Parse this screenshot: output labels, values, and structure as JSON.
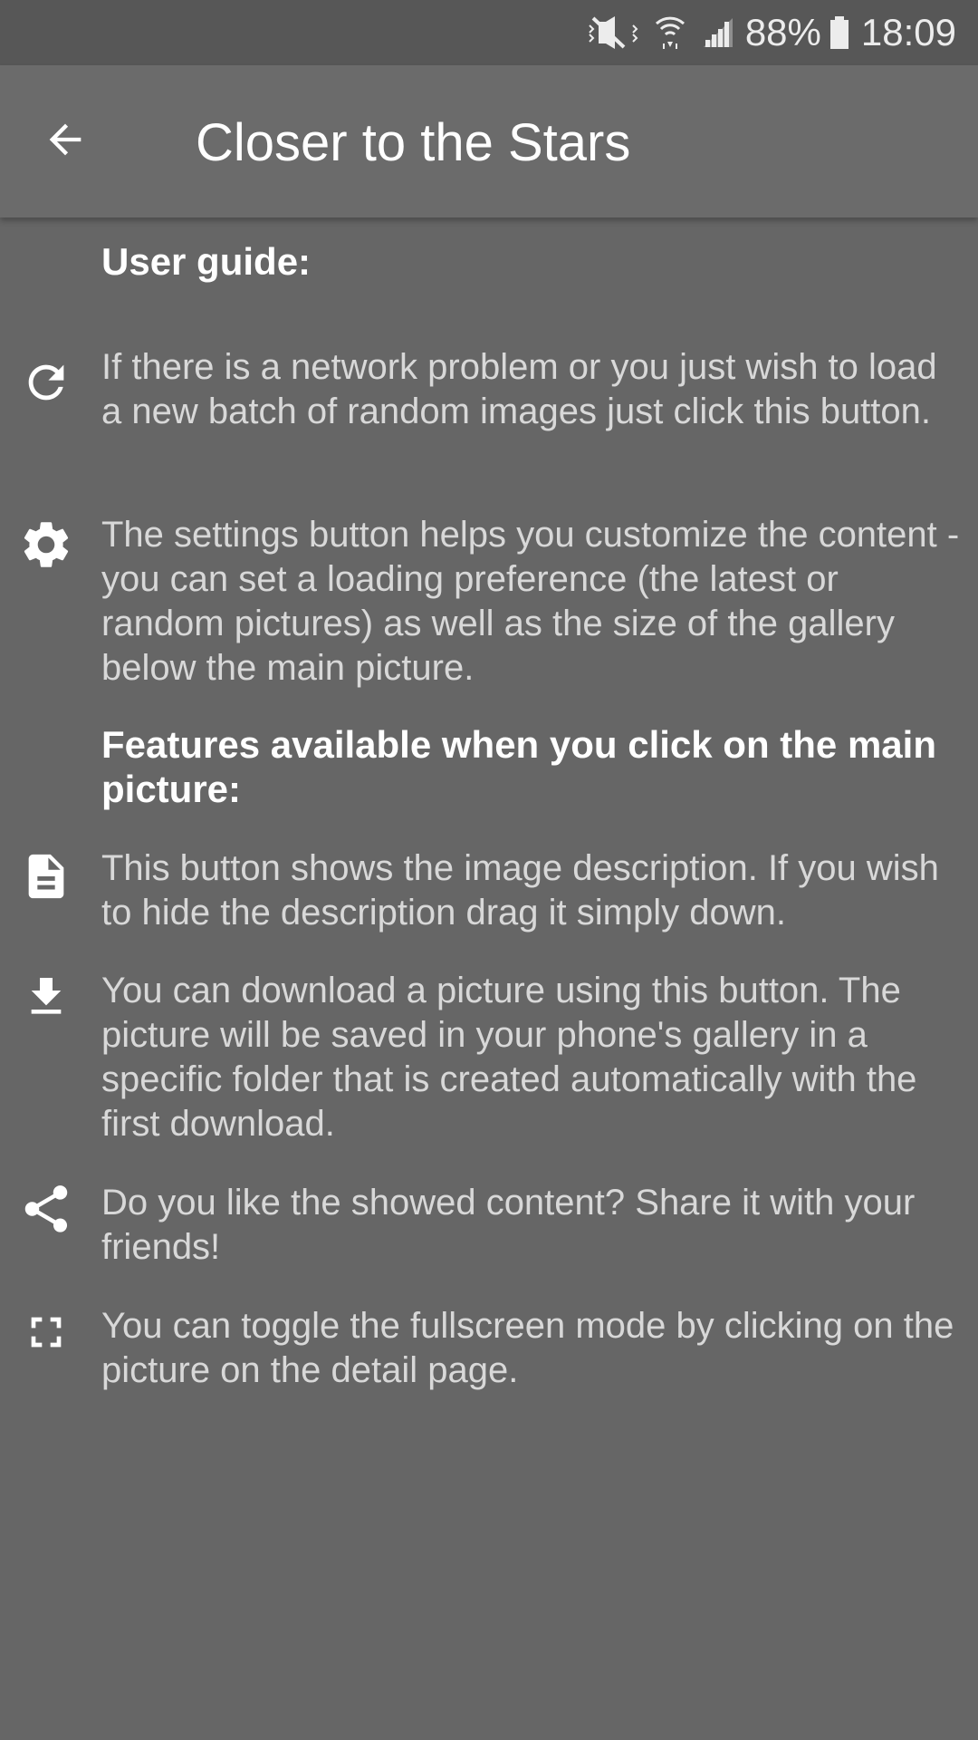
{
  "status_bar": {
    "battery": "88%",
    "time": "18:09",
    "icons": [
      "mute-icon",
      "wifi-icon",
      "signal-icon",
      "battery-icon"
    ]
  },
  "toolbar": {
    "title": "Closer to the Stars",
    "back_icon": "arrow-back-icon"
  },
  "guide": {
    "heading": "User guide:",
    "items": [
      {
        "icon": "refresh-icon",
        "text": "If there is a network problem or you just wish to load a new batch of random images just click this button."
      },
      {
        "icon": "settings-icon",
        "text": "The settings button helps you customize the content - you can set a loading preference (the latest or random pictures) as well as the size of the gallery below the main picture."
      }
    ],
    "features_heading": "Features available when you click on the main picture:",
    "features": [
      {
        "icon": "description-icon",
        "text": "This button shows the image description. If you wish to hide the description drag it simply down."
      },
      {
        "icon": "download-icon",
        "text": "You can download a picture using this button. The picture will be saved in your phone's gallery in a specific folder that is created automatically with the first download."
      },
      {
        "icon": "share-icon",
        "text": "Do you like the showed content? Share it with your friends!"
      },
      {
        "icon": "fullscreen-icon",
        "text": "You can toggle the fullscreen mode by clicking on the picture on the detail page."
      }
    ]
  },
  "colors": {
    "background": "#666666",
    "toolbar": "#6b6b6b",
    "status_bar": "#575757",
    "heading_text": "#ffffff",
    "body_text": "#d8d8d8"
  }
}
